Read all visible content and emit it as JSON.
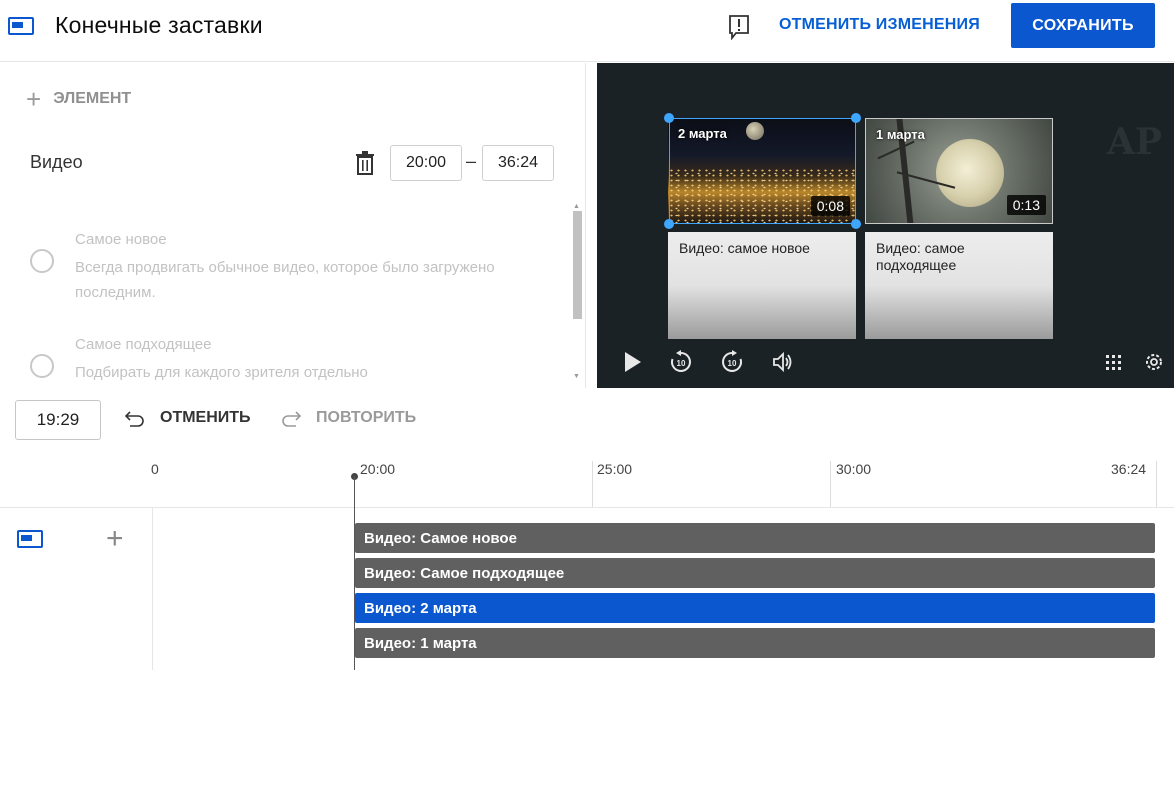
{
  "header": {
    "title": "Конечные заставки",
    "undo_all_label": "ОТМЕНИТЬ ИЗМЕНЕНИЯ",
    "save_label": "СОХРАНИТЬ"
  },
  "editor": {
    "add_element_label": "ЭЛЕМЕНТ",
    "element_type_label": "Видео",
    "start_time": "20:00",
    "end_time": "36:24",
    "options": [
      {
        "title": "Самое новое",
        "description": "Всегда продвигать обычное видео, которое было загружено последним."
      },
      {
        "title": "Самое подходящее",
        "description": "Подбирать для каждого зрителя отдельно"
      }
    ]
  },
  "preview": {
    "cards": [
      {
        "thumb_title": "2 марта",
        "duration": "0:08",
        "caption": "Видео: самое новое"
      },
      {
        "thumb_title": "1 марта",
        "duration": "0:13",
        "caption": "Видео: самое подходящее"
      }
    ],
    "background_text": "AP"
  },
  "timeline": {
    "current_time": "19:29",
    "undo_label": "ОТМЕНИТЬ",
    "redo_label": "ПОВТОРИТЬ",
    "ticks": [
      "0",
      "20:00",
      "25:00",
      "30:00",
      "36:24"
    ],
    "bars": [
      {
        "label": "Видео: Самое новое",
        "active": false
      },
      {
        "label": "Видео: Самое подходящее",
        "active": false
      },
      {
        "label": "Видео: 2 марта",
        "active": true
      },
      {
        "label": "Видео: 1 марта",
        "active": false
      }
    ]
  },
  "colors": {
    "accent": "#0b57d0",
    "link": "#065fd4",
    "selection": "#3ea6ff",
    "bar_default": "#606060"
  }
}
